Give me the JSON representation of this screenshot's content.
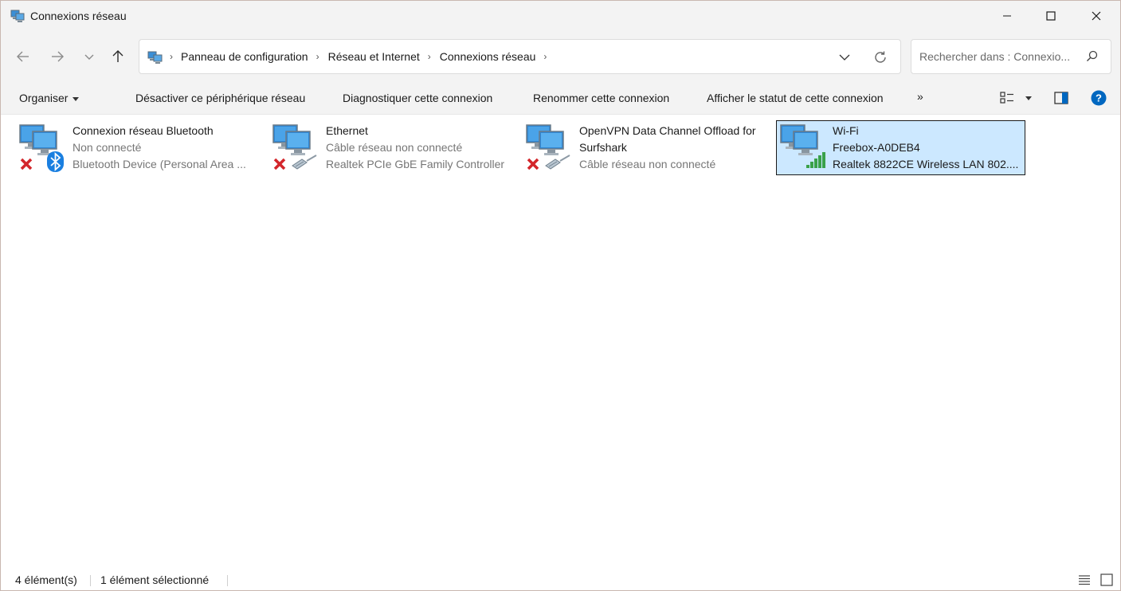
{
  "window": {
    "title": "Connexions réseau",
    "accent_color": "#0067c0",
    "selection_color": "#cce8ff"
  },
  "titlebar": {
    "icons": [
      "network-connections-icon",
      "minimize-icon",
      "maximize-icon",
      "close-icon"
    ]
  },
  "address": {
    "crumbs": [
      "Panneau de configuration",
      "Réseau et Internet",
      "Connexions réseau"
    ],
    "search_placeholder": "Rechercher dans : Connexio..."
  },
  "toolbar": {
    "organize_label": "Organiser",
    "commands": [
      "Désactiver ce périphérique réseau",
      "Diagnostiquer cette connexion",
      "Renommer cette connexion",
      "Afficher le statut de cette connexion"
    ],
    "more_label": "»"
  },
  "connections": [
    {
      "name": "Connexion réseau Bluetooth",
      "status": "Non connecté",
      "device": "Bluetooth Device (Personal Area ...",
      "badge": "bluetooth-icon",
      "disconnected": true,
      "selected": false
    },
    {
      "name": "Ethernet",
      "status": "Câble réseau non connecté",
      "device": "Realtek PCIe GbE Family Controller",
      "badge": "ethernet-cable-icon",
      "disconnected": true,
      "selected": false
    },
    {
      "name_line1": "OpenVPN Data Channel Offload for",
      "name_line2": "Surfshark",
      "status": "Câble réseau non connecté",
      "badge": "ethernet-cable-icon",
      "disconnected": true,
      "selected": false
    },
    {
      "name": "Wi-Fi",
      "status": "Freebox-A0DEB4",
      "device": "Realtek 8822CE Wireless LAN 802....",
      "badge": "wifi-signal-icon",
      "disconnected": false,
      "selected": true
    }
  ],
  "statusbar": {
    "count": "4 élément(s)",
    "selected": "1 élément sélectionné"
  }
}
